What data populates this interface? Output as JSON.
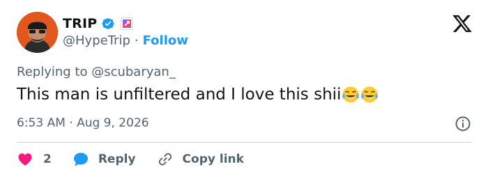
{
  "author": {
    "display_name": "TRIP",
    "handle": "@HypeTrip",
    "separator": "·",
    "follow_label": "Follow"
  },
  "reply_context": {
    "prefix": "Replying to ",
    "mention": "@scubaryan_"
  },
  "tweet": {
    "text": "This man is unfiltered and I love this shii",
    "emojis": [
      "face-with-tears-of-joy-icon",
      "face-with-tears-of-joy-icon"
    ]
  },
  "timestamp": "6:53 AM · Aug 9, 2026",
  "actions": {
    "likes_count": "2",
    "reply_label": "Reply",
    "copy_link_label": "Copy link"
  },
  "colors": {
    "accent": "#1d9bf0",
    "like": "#f91880",
    "muted": "#536471",
    "text": "#0f1419"
  }
}
